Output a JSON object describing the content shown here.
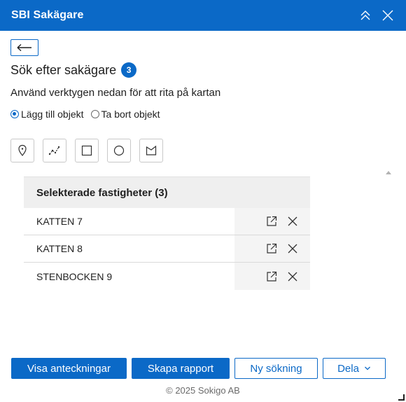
{
  "window": {
    "title": "SBI Sakägare"
  },
  "search": {
    "title": "Sök efter sakägare",
    "count": "3",
    "instruction": "Använd verktygen nedan för att rita på kartan"
  },
  "mode": {
    "options": [
      {
        "label": "Lägg till objekt",
        "selected": true
      },
      {
        "label": "Ta bort objekt",
        "selected": false
      }
    ]
  },
  "tools": [
    {
      "icon": "point-tool-icon"
    },
    {
      "icon": "polyline-tool-icon"
    },
    {
      "icon": "rectangle-tool-icon"
    },
    {
      "icon": "circle-tool-icon"
    },
    {
      "icon": "polygon-tool-icon"
    }
  ],
  "table": {
    "header": "Selekterade fastigheter (3)",
    "rows": [
      {
        "name": "KATTEN 7"
      },
      {
        "name": "KATTEN 8"
      },
      {
        "name": "STENBOCKEN 9"
      }
    ]
  },
  "footer": {
    "notes_label": "Visa anteckningar",
    "report_label": "Skapa rapport",
    "new_search_label": "Ny sökning",
    "share_label": "Dela",
    "copyright": "© 2025 Sokigo AB"
  },
  "colors": {
    "accent": "#0b69c7",
    "header_bg": "#0b69c7"
  }
}
